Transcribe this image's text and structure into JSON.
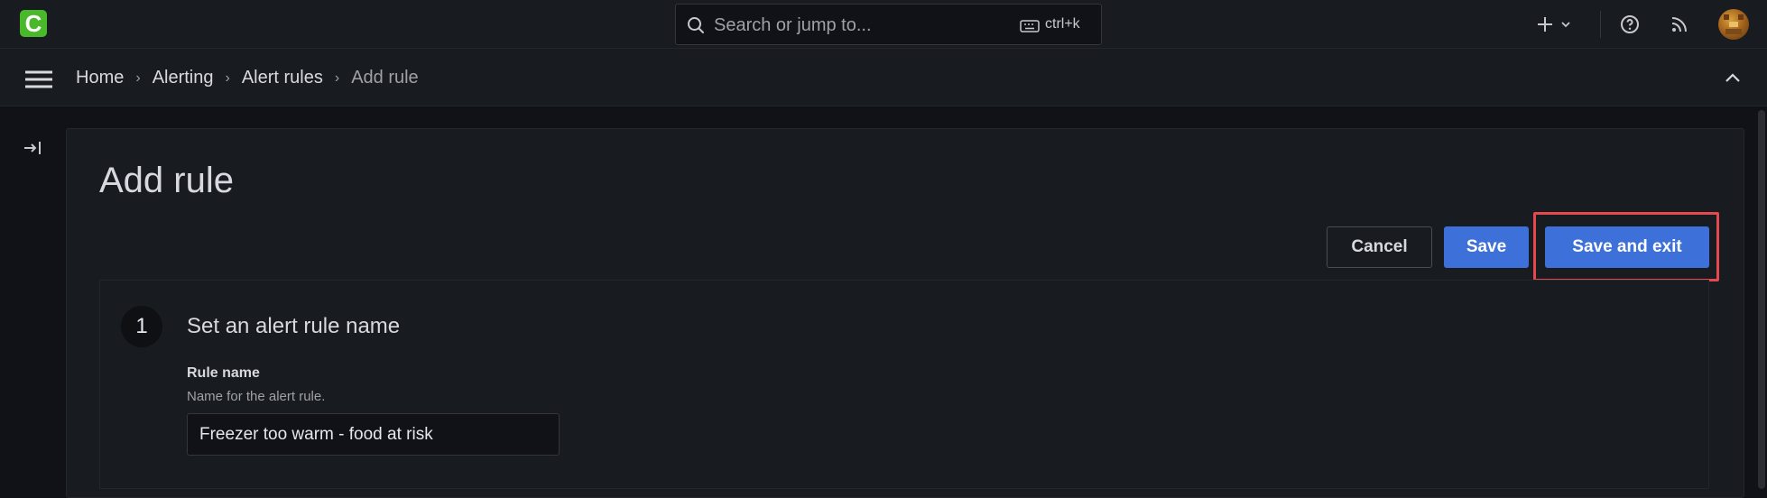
{
  "app": {
    "logo_letter": "C",
    "brand_color": "#4ab82b",
    "accent": "#3d71d9"
  },
  "search": {
    "placeholder": "Search or jump to...",
    "shortcut": "ctrl+k"
  },
  "topbar": {
    "add_icon": "plus-icon",
    "help_icon": "help-icon",
    "news_icon": "rss-icon"
  },
  "breadcrumb": [
    {
      "label": "Home"
    },
    {
      "label": "Alerting"
    },
    {
      "label": "Alert rules"
    },
    {
      "label": "Add rule"
    }
  ],
  "page": {
    "title": "Add rule",
    "actions": {
      "cancel": "Cancel",
      "save": "Save",
      "save_and_exit": "Save and exit"
    }
  },
  "step1": {
    "number": "1",
    "title": "Set an alert rule name",
    "rule_name": {
      "label": "Rule name",
      "description": "Name for the alert rule.",
      "value": "Freezer too warm - food at risk"
    }
  }
}
